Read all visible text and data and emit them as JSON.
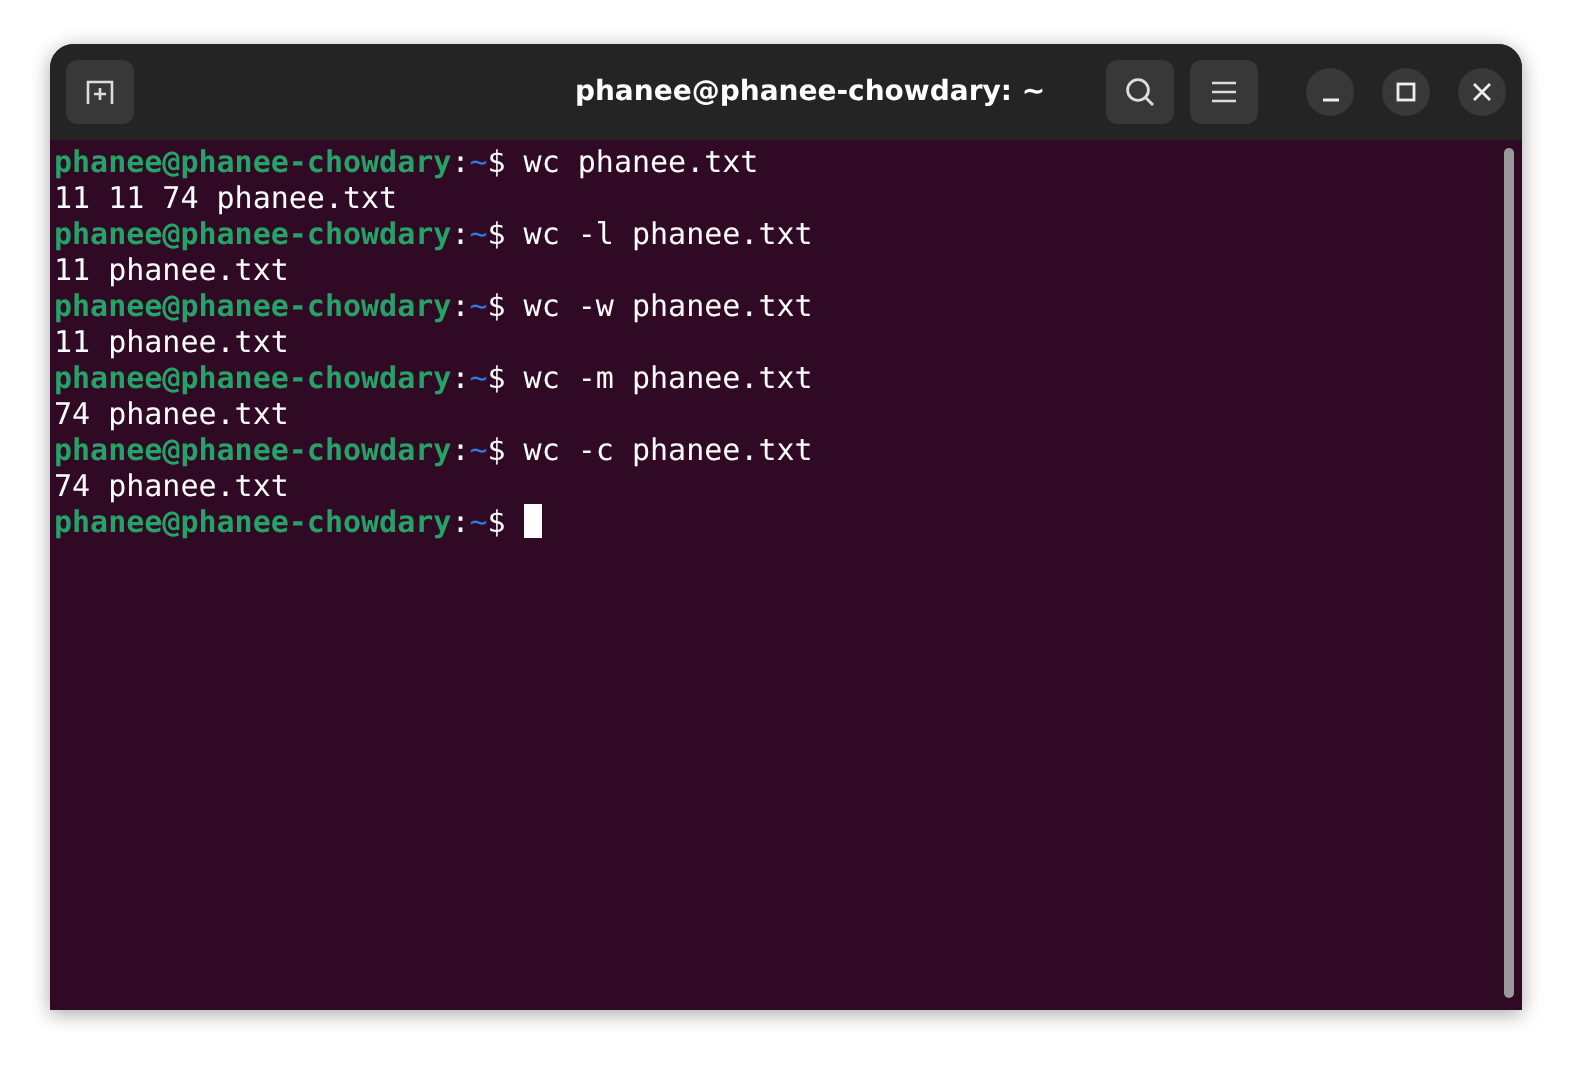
{
  "window": {
    "title": "phanee@phanee-chowdary: ~"
  },
  "lines": [
    {
      "kind": "prompt",
      "user": "phanee@phanee-chowdary",
      "sep": ":",
      "path": "~",
      "symbol": "$",
      "command": "wc phanee.txt",
      "cursor": false
    },
    {
      "kind": "output",
      "text": "11 11 74 phanee.txt"
    },
    {
      "kind": "prompt",
      "user": "phanee@phanee-chowdary",
      "sep": ":",
      "path": "~",
      "symbol": "$",
      "command": "wc -l phanee.txt",
      "cursor": false
    },
    {
      "kind": "output",
      "text": "11 phanee.txt"
    },
    {
      "kind": "prompt",
      "user": "phanee@phanee-chowdary",
      "sep": ":",
      "path": "~",
      "symbol": "$",
      "command": "wc -w phanee.txt",
      "cursor": false
    },
    {
      "kind": "output",
      "text": "11 phanee.txt"
    },
    {
      "kind": "prompt",
      "user": "phanee@phanee-chowdary",
      "sep": ":",
      "path": "~",
      "symbol": "$",
      "command": "wc -m phanee.txt",
      "cursor": false
    },
    {
      "kind": "output",
      "text": "74 phanee.txt"
    },
    {
      "kind": "prompt",
      "user": "phanee@phanee-chowdary",
      "sep": ":",
      "path": "~",
      "symbol": "$",
      "command": "wc -c phanee.txt",
      "cursor": false
    },
    {
      "kind": "output",
      "text": "74 phanee.txt"
    },
    {
      "kind": "prompt",
      "user": "phanee@phanee-chowdary",
      "sep": ":",
      "path": "~",
      "symbol": "$",
      "cursor": true
    }
  ]
}
